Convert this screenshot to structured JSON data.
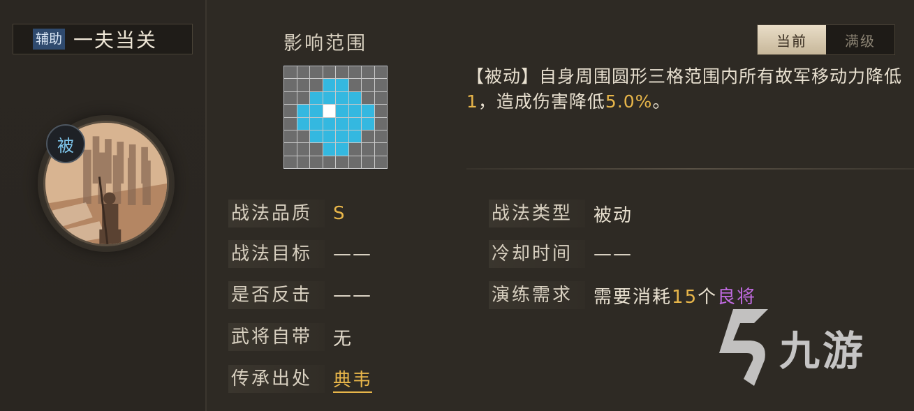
{
  "skill": {
    "category_tag": "辅助",
    "name": "一夫当关",
    "passive_badge": "被"
  },
  "range": {
    "title": "影响范围",
    "grid_rows": [
      "00000000",
      "00011000",
      "00111100",
      "01122110",
      "01122110",
      "00111100",
      "00011000",
      "00000000"
    ]
  },
  "tabs": {
    "current": "当前",
    "max": "满级"
  },
  "description": {
    "prefix": "【被动】自身周围圆形三格范围内所有故军移动力降低",
    "value1": "1",
    "middle": "，造成伤害降低",
    "value2": "5.0%",
    "suffix": "。"
  },
  "info": {
    "quality_label": "战法品质",
    "quality_value": "S",
    "target_label": "战法目标",
    "target_value": "——",
    "counter_label": "是否反击",
    "counter_value": "——",
    "innate_label": "武将自带",
    "innate_value": "无",
    "origin_label": "传承出处",
    "origin_value": "典韦",
    "type_label": "战法类型",
    "type_value": "被动",
    "cooldown_label": "冷却时间",
    "cooldown_value": "——",
    "drill_label": "演练需求",
    "drill_prefix": "需要消耗",
    "drill_count": "15",
    "drill_unit": "个",
    "drill_item": "良将"
  },
  "watermark": {
    "text": "九游",
    "logo_icon": "jiuyou-logo-icon"
  },
  "colors": {
    "range_cell": "#34b8e0",
    "highlight": "#e8b64a",
    "rare_item": "#c06ae0"
  }
}
